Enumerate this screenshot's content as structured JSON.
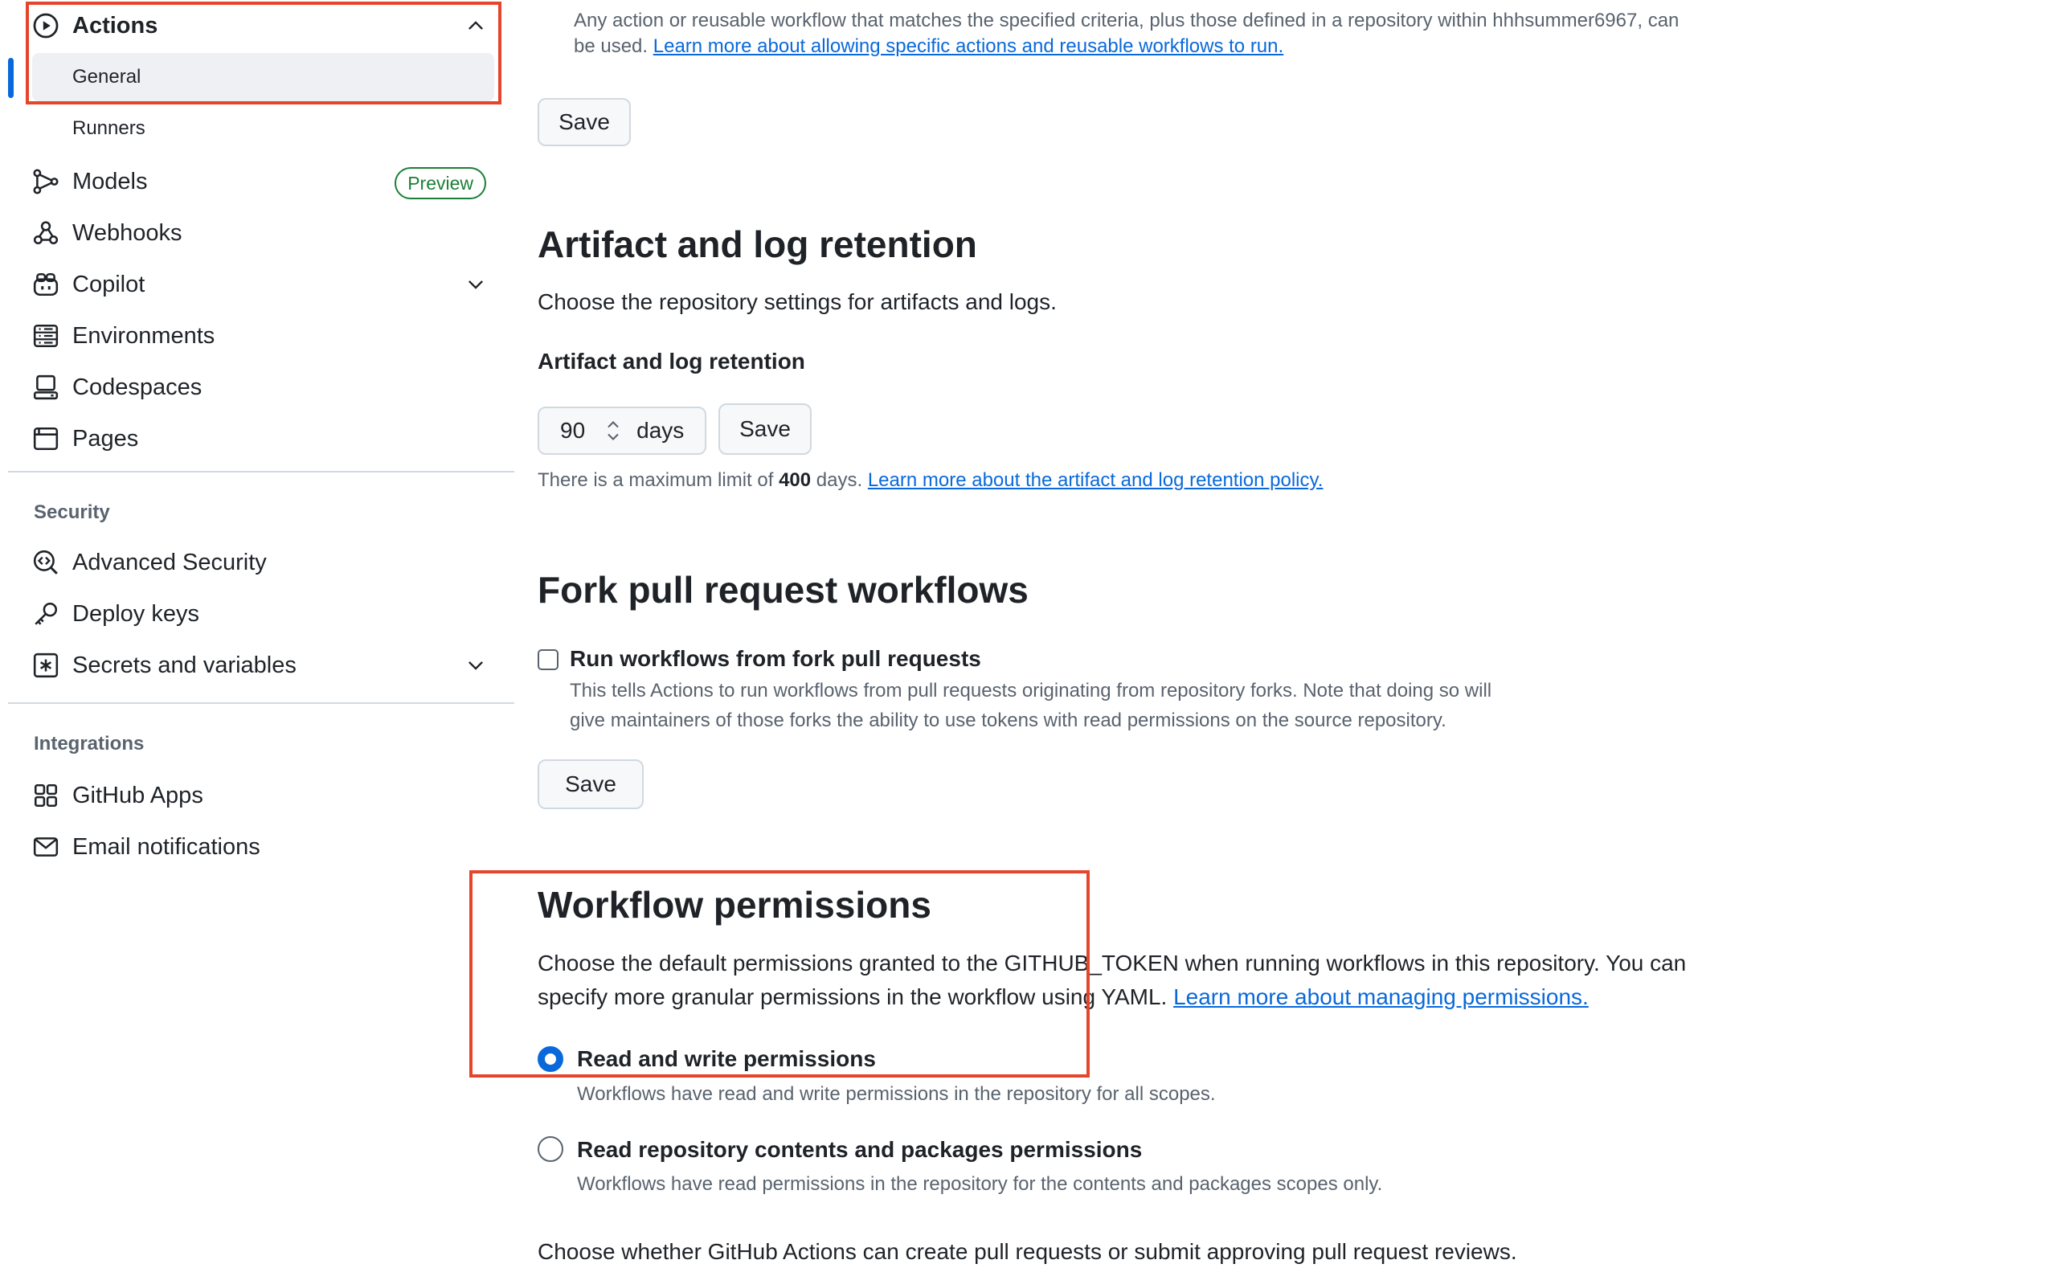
{
  "sidebar": {
    "actions_label": "Actions",
    "general_label": "General",
    "runners_label": "Runners",
    "models_label": "Models",
    "models_badge": "Preview",
    "webhooks_label": "Webhooks",
    "copilot_label": "Copilot",
    "environments_label": "Environments",
    "codespaces_label": "Codespaces",
    "pages_label": "Pages",
    "security_heading": "Security",
    "advanced_security_label": "Advanced Security",
    "deploy_keys_label": "Deploy keys",
    "secrets_label": "Secrets and variables",
    "integrations_heading": "Integrations",
    "github_apps_label": "GitHub Apps",
    "email_notifications_label": "Email notifications"
  },
  "allowed_actions": {
    "description_line1": "Any action or reusable workflow that matches the specified criteria, plus those defined in a repository within hhhsummer6967, can",
    "description_line2_prefix": "be used.",
    "learn_more_link": "Learn more about allowing specific actions and reusable workflows to run.",
    "save_label": "Save"
  },
  "artifact_retention": {
    "title": "Artifact and log retention",
    "description": "Choose the repository settings for artifacts and logs.",
    "field_label": "Artifact and log retention",
    "days_value": "90",
    "days_unit": "days",
    "save_label": "Save",
    "limit_prefix": "There is a maximum limit of",
    "limit_value": "400",
    "limit_suffix": "days.",
    "learn_more_link": "Learn more about the artifact and log retention policy."
  },
  "fork_workflows": {
    "title": "Fork pull request workflows",
    "checkbox_label": "Run workflows from fork pull requests",
    "checkbox_checked": false,
    "description_line1": "This tells Actions to run workflows from pull requests originating from repository forks. Note that doing so will",
    "description_line2": "give maintainers of those forks the ability to use tokens with read permissions on the source repository.",
    "save_label": "Save"
  },
  "workflow_permissions": {
    "title": "Workflow permissions",
    "description_line1": "Choose the default permissions granted to the GITHUB_TOKEN when running workflows in this repository. You can",
    "description_line2_prefix": "specify more granular permissions in the workflow using YAML.",
    "learn_more_link": "Learn more about managing permissions.",
    "options": [
      {
        "label": "Read and write permissions",
        "description": "Workflows have read and write permissions in the repository for all scopes.",
        "selected": true
      },
      {
        "label": "Read repository contents and packages permissions",
        "description": "Workflows have read permissions in the repository for the contents and packages scopes only.",
        "selected": false
      }
    ],
    "pr_creation_text": "Choose whether GitHub Actions can create pull requests or submit approving pull request reviews."
  },
  "colors": {
    "link": "#0969da",
    "accent": "#0969da",
    "highlight_box": "#e5452b",
    "badge_green": "#1a7f37",
    "radio_selected": "#0969da"
  }
}
